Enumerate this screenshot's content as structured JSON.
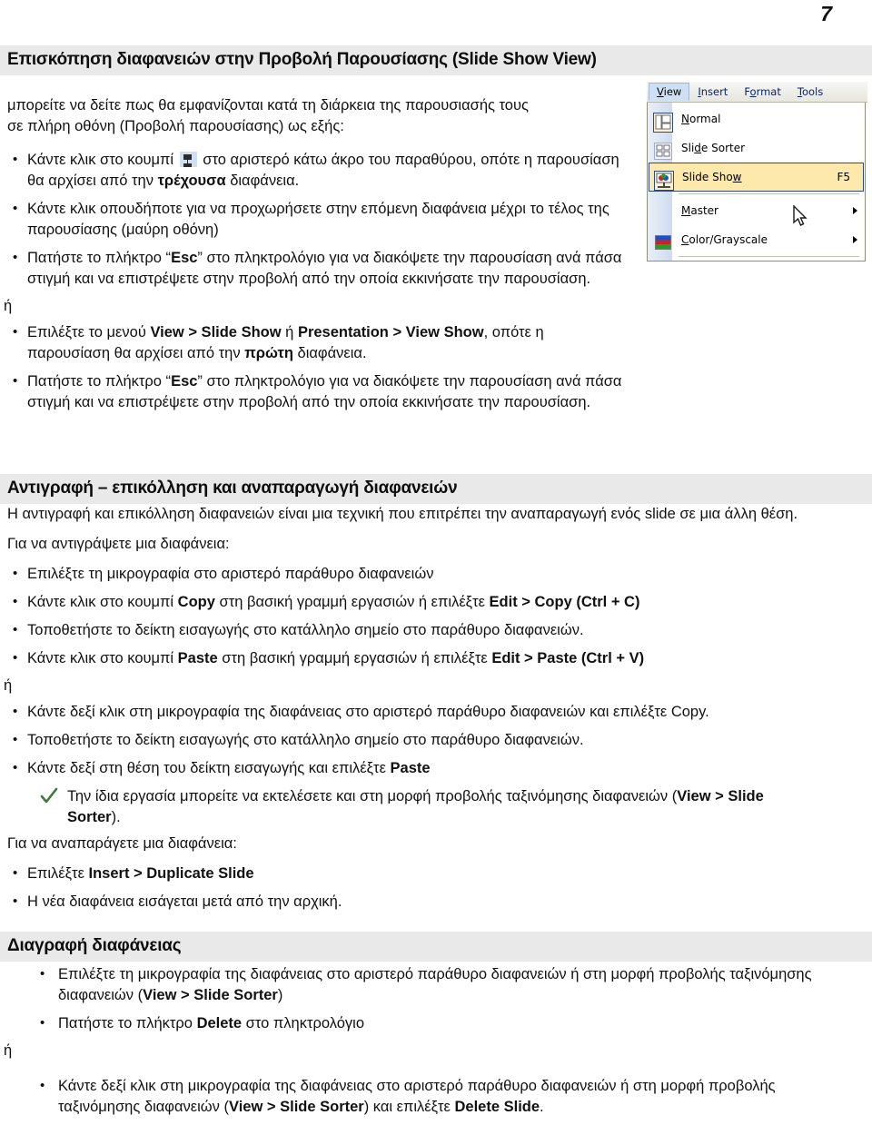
{
  "page": {
    "number": "7"
  },
  "section1": {
    "heading": "Επισκόπηση διαφανειών στην Προβολή Παρουσίασης (Slide Show View)",
    "intro_line1": "μπορείτε να δείτε πως θα εμφανίζονται κατά τη διάρκεια της παρουσιασής τους",
    "intro_line2": "σε πλήρη οθόνη (Προβολή παρουσίασης) ως εξής:",
    "bullets": [
      {
        "pre": "Κάντε κλικ στο κουμπί ",
        "icon": "slide-show-button-icon",
        "post": " στο αριστερό κάτω άκρο του παραθύρου, οπότε η παρουσίαση θα αρχίσει από την ",
        "bold": "τρέχουσα",
        "tail": " διαφάνεια."
      },
      {
        "text": "Κάντε κλικ οπουδήποτε για να προχωρήσετε στην επόμενη διαφάνεια μέχρι το τέλος της παρουσίασης (μαύρη οθόνη)"
      },
      {
        "pre": "Πατήστε το πλήκτρο “",
        "bold": "Esc",
        "post": "” στο πληκτρολόγιο για να διακόψετε την παρουσίαση ανά πάσα στιγμή και να επιστρέψετε στην προβολή από την οποία εκκινήσατε την παρουσίαση."
      }
    ],
    "or": "ή",
    "bullets2": [
      {
        "pre": "Επιλέξτε το μενού ",
        "bold1": "View > Slide Show",
        "mid": " ή ",
        "bold2": "Presentation > View Show",
        "post": ", οπότε η παρουσίαση θα αρχίσει από την ",
        "bold3": "πρώτη",
        "tail": " διαφάνεια."
      },
      {
        "pre": "Πατήστε το πλήκτρο “",
        "bold": "Esc",
        "post": "” στο πληκτρολόγιο για να διακόψετε την παρουσίαση ανά πάσα στιγμή και να επιστρέψετε στην προβολή από την οποία εκκινήσατε την παρουσίαση."
      }
    ]
  },
  "menu_screenshot": {
    "menubar": [
      {
        "label": "View",
        "accel": "V",
        "active": true
      },
      {
        "label": "Insert",
        "accel": "I",
        "active": false
      },
      {
        "label": "Format",
        "accel": "o",
        "active": false
      },
      {
        "label": "Tools",
        "accel": "T",
        "active": false
      }
    ],
    "items": [
      {
        "label": "Normal",
        "icon": "normal-view-icon",
        "shortcut": "",
        "submenu": false,
        "selected": false
      },
      {
        "label": "Slide Sorter",
        "icon": "slide-sorter-icon",
        "shortcut": "",
        "submenu": false,
        "selected": false
      },
      {
        "label": "Slide Show",
        "icon": "slide-show-icon",
        "shortcut": "F5",
        "submenu": false,
        "selected": true
      },
      {
        "label": "Master",
        "icon": "",
        "shortcut": "",
        "submenu": true,
        "selected": false
      },
      {
        "label": "Color/Grayscale",
        "icon": "color-grayscale-icon",
        "shortcut": "",
        "submenu": true,
        "selected": false
      }
    ],
    "cursor": "mouse-pointer-icon",
    "highlight_color": "#fde9ab",
    "gutter_color": "#cfdcef"
  },
  "section2": {
    "heading": "Αντιγραφή – επικόλληση και αναπαραγωγή διαφανειών",
    "intro": "Η αντιγραφή και επικόλληση διαφανειών είναι μια τεχνική που επιτρέπει την αναπαραγωγή ενός slide σε μια άλλη θέση.",
    "lead1": "Για να αντιγράψετε μια διαφάνεια:",
    "bullets": [
      {
        "text": "Επιλέξτε τη μικρογραφία στο αριστερό παράθυρο διαφανειών"
      },
      {
        "pre": "Κάντε κλικ στο κουμπί ",
        "bold1": "Copy",
        "mid": " στη βασική γραμμή εργασιών ή επιλέξτε ",
        "bold2": "Edit > Copy (Ctrl + C)",
        "post": ""
      },
      {
        "text": "Τοποθετήστε το δείκτη εισαγωγής στο κατάλληλο σημείο στο παράθυρο διαφανειών."
      },
      {
        "pre": "Κάντε κλικ στο κουμπί ",
        "bold1": "Paste",
        "mid": " στη βασική γραμμή εργασιών ή επιλέξτε ",
        "bold2": "Edit > Paste (Ctrl + V)",
        "post": ""
      }
    ],
    "or": "ή",
    "bullets2": [
      {
        "text": "Κάντε δεξί κλικ στη μικρογραφία της διαφάνειας στο αριστερό παράθυρο διαφανειών και επιλέξτε Copy."
      },
      {
        "text": "Τοποθετήστε το δείκτη εισαγωγής στο κατάλληλο σημείο στο παράθυρο διαφανειών."
      },
      {
        "pre": "Κάντε δεξί στη θέση του δείκτη εισαγωγής και επιλέξτε ",
        "bold1": "Paste",
        "mid": "",
        "bold2": "",
        "post": ""
      }
    ],
    "note": {
      "icon": "check-mark-icon",
      "icon_color": "#3a7a3a",
      "pre": "Την ίδια εργασία μπορείτε να εκτελέσετε και στη μορφή προβολής ταξινόμησης διαφανειών (",
      "bold": "View > Slide Sorter",
      "post": ")."
    },
    "lead2": "Για να αναπαράγετε μια διαφάνεια:",
    "bullets3": [
      {
        "pre": "Επιλέξτε ",
        "bold": "Insert > Duplicate Slide",
        "post": ""
      },
      {
        "pre": "Η νέα διαφάνεια εισάγεται μετά από την αρχική.",
        "bold": "",
        "post": ""
      }
    ]
  },
  "section3": {
    "heading": "Διαγραφή διαφάνειας",
    "bullets": [
      {
        "pre": "Επιλέξτε τη μικρογραφία της διαφάνειας στο αριστερό παράθυρο διαφανειών ή  στη μορφή προβολής ταξινόμησης διαφανειών (",
        "bold": "View > Slide Sorter",
        "post": ")"
      },
      {
        "pre": "Πατήστε το πλήκτρο ",
        "bold": "Delete",
        "post": " στο πληκτρολόγιο"
      }
    ],
    "or": "ή",
    "bullets2": [
      {
        "pre": "Κάντε δεξί κλικ στη μικρογραφία της διαφάνειας στο αριστερό παράθυρο διαφανειών ή  στη μορφή προβολής ταξινόμησης διαφανειών (",
        "bold1": "View > Slide Sorter",
        "mid": ") και επιλέξτε ",
        "bold2": "Delete Slide",
        "post": "."
      }
    ]
  }
}
